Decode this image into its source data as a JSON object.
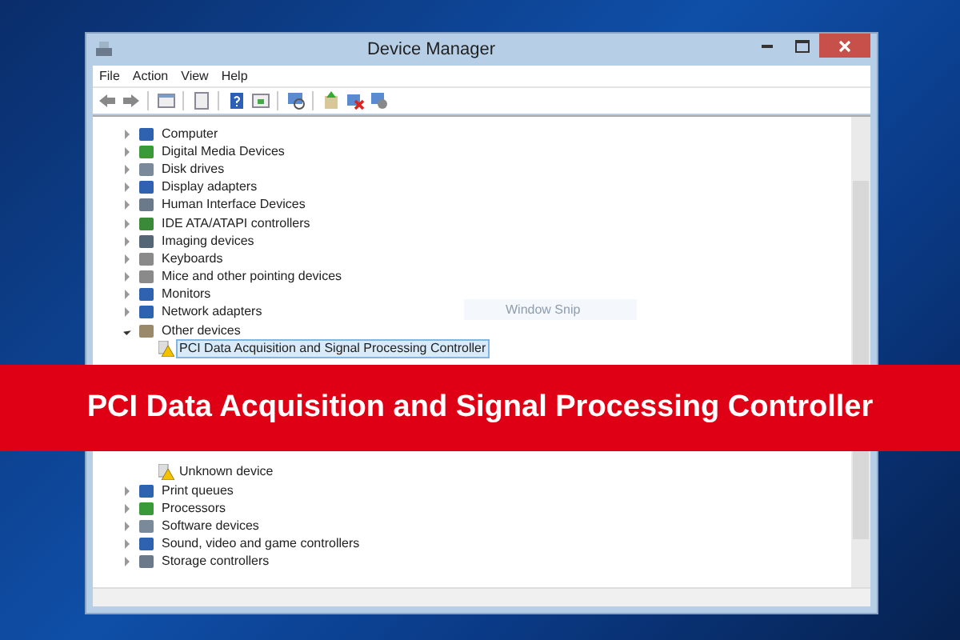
{
  "window": {
    "title": "Device Manager"
  },
  "menu": [
    "File",
    "Action",
    "View",
    "Help"
  ],
  "tree": [
    {
      "label": "Computer",
      "expanded": false
    },
    {
      "label": "Digital Media Devices",
      "expanded": false
    },
    {
      "label": "Disk drives",
      "expanded": false
    },
    {
      "label": "Display adapters",
      "expanded": false
    },
    {
      "label": "Human Interface Devices",
      "expanded": false
    },
    {
      "label": "IDE ATA/ATAPI controllers",
      "expanded": false
    },
    {
      "label": "Imaging devices",
      "expanded": false
    },
    {
      "label": "Keyboards",
      "expanded": false
    },
    {
      "label": "Mice and other pointing devices",
      "expanded": false
    },
    {
      "label": "Monitors",
      "expanded": false
    },
    {
      "label": "Network adapters",
      "expanded": false
    },
    {
      "label": "Other devices",
      "expanded": true,
      "children": [
        {
          "label": "PCI Data Acquisition and Signal Processing Controller",
          "selected": true
        },
        {
          "label": "Unknown device",
          "selected": false
        }
      ]
    },
    {
      "label": "Print queues",
      "expanded": false
    },
    {
      "label": "Processors",
      "expanded": false
    },
    {
      "label": "Software devices",
      "expanded": false
    },
    {
      "label": "Sound, video and game controllers",
      "expanded": false
    },
    {
      "label": "Storage controllers",
      "expanded": false
    }
  ],
  "ghost_label": "Window Snip",
  "banner": "PCI Data Acquisition and Signal Processing Controller"
}
